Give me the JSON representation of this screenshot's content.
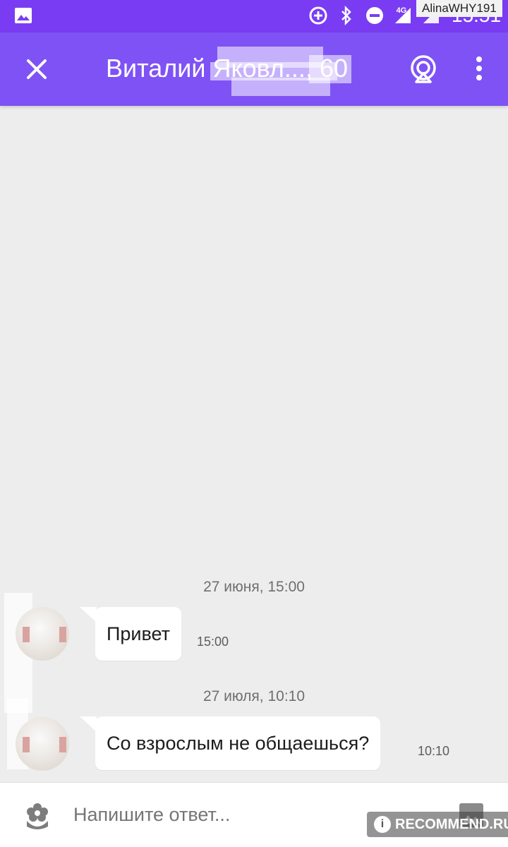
{
  "status_bar": {
    "time": "15:51",
    "network": "4G",
    "icons": [
      "image-icon",
      "data-saver-icon",
      "bluetooth-icon",
      "do-not-disturb-icon",
      "signal-icon",
      "battery-icon"
    ],
    "watermark_user": "AlinaWHY191"
  },
  "header": {
    "title": "Виталий Яковл..., 60",
    "close_icon": "close-icon",
    "broadcast_icon": "broadcast-icon",
    "menu_icon": "more-vert-icon"
  },
  "messages": [
    {
      "date": "27 июня, 15:00",
      "text": "Привет",
      "time": "15:00"
    },
    {
      "date": "27 июля, 10:10",
      "text": "Со взрослым не общаешься?",
      "time": "10:10"
    }
  ],
  "composer": {
    "placeholder": "Напишите ответ...",
    "sticker_icon": "sticker-icon",
    "photo_icon": "photo-icon"
  },
  "watermark_site": "RECOMMEND.RU",
  "colors": {
    "status_bar": "#7a3cf2",
    "app_bar": "#7f52f5",
    "background": "#ededed",
    "bubble": "#ffffff"
  }
}
